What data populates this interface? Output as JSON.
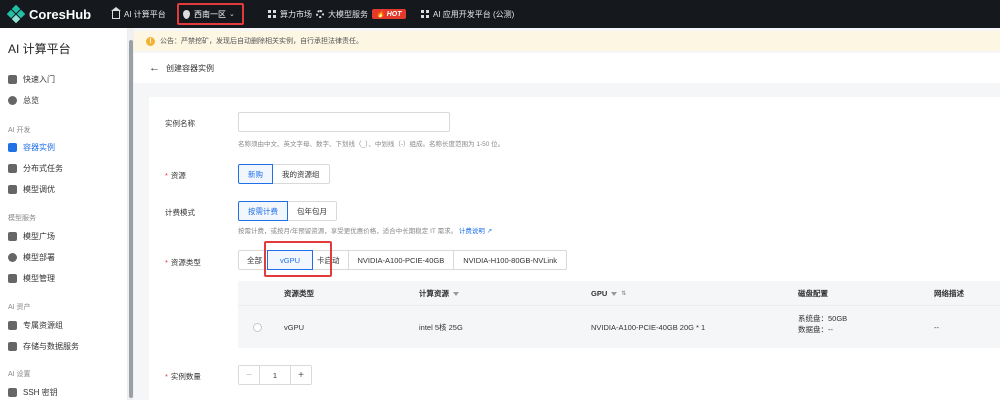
{
  "topbar": {
    "brand": "CoresHub",
    "nav_compute_platform": "AI 计算平台",
    "region": "西南一区",
    "nav_compute_market": "算力市场",
    "nav_model_service": "大模型服务",
    "hot_badge": "HOT",
    "nav_app_platform": "AI 应用开发平台 (公测)"
  },
  "sidebar": {
    "title": "AI 计算平台",
    "quick_start": "快速入门",
    "overview": "总览",
    "group_dev": "AI 开发",
    "container_instances": "容器实例",
    "distributed_tasks": "分布式任务",
    "model_tuning": "模型调优",
    "group_model": "模型服务",
    "model_square": "模型广场",
    "model_deploy": "模型部署",
    "model_manage": "模型管理",
    "group_assets": "AI 资产",
    "dedicated_resources": "专属资源组",
    "storage_data": "存储与数据服务",
    "group_settings": "AI 设置",
    "ssh_keys": "SSH 密钥"
  },
  "notice": {
    "text": "公告：严禁挖矿，发现后自动删除相关实例，自行承担法律责任。"
  },
  "header": {
    "title": "创建容器实例"
  },
  "form": {
    "name_label": "实例名称",
    "name_placeholder": "",
    "name_hint": "名称须由中文、英文字母、数字、下划线（_）、中划线（-）组成。名称长度范围为 1-50 位。",
    "resource_label": "资源",
    "resource_options": [
      "新购",
      "我的资源组"
    ],
    "billing_label": "计费模式",
    "billing_options": [
      "按需计费",
      "包年包月"
    ],
    "billing_hint": "按需计费，或按月/年预留资源，享受更优惠价格，适合中长期稳定 IT 需求。",
    "billing_link": "计费说明",
    "type_label": "资源类型",
    "type_options": [
      "全部",
      "vGPU",
      "卡启动",
      "NVIDIA-A100-PCIE-40GB",
      "NVIDIA-H100-80GB-NVLink"
    ],
    "quantity_label": "实例数量",
    "quantity_value": "1",
    "minus": "−",
    "plus": "+"
  },
  "table": {
    "headers": [
      "资源类型",
      "计算资源",
      "GPU",
      "磁盘配置",
      "网络描述"
    ],
    "row": {
      "type": "vGPU",
      "compute": "intel 5核 25G",
      "gpu": "NVIDIA-A100-PCIE-40GB 20G * 1",
      "disk_system": "系统盘：50GB",
      "disk_data": "数据盘：--",
      "network": "--"
    }
  },
  "colors": {
    "accent": "#1f6fe5",
    "highlight": "#e23b3b",
    "brand": "#21c1a8",
    "hot": "#e43a2b"
  }
}
